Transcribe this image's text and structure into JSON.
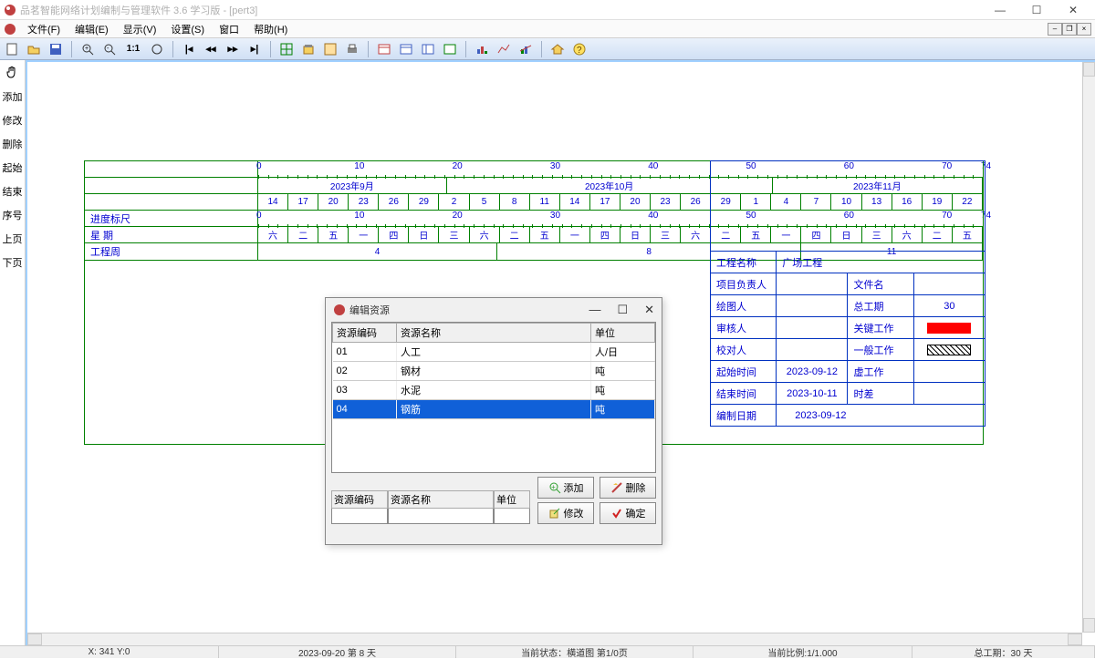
{
  "titlebar": {
    "text": "品茗智能网络计划编制与管理软件 3.6 学习版 - [pert3]"
  },
  "menu": {
    "file": "文件(F)",
    "edit": "编辑(E)",
    "view": "显示(V)",
    "settings": "设置(S)",
    "window": "窗口",
    "help": "帮助(H)"
  },
  "left_tools": [
    "添加",
    "修改",
    "删除",
    "起始",
    "结束",
    "序号",
    "上页",
    "下页"
  ],
  "gantt": {
    "scale_ticks": [
      "0",
      "10",
      "20",
      "30",
      "40",
      "50",
      "60",
      "70",
      "74"
    ],
    "months": [
      "2023年9月",
      "2023年10月",
      "2023年11月"
    ],
    "dates": [
      "14",
      "17",
      "20",
      "23",
      "26",
      "29",
      "2",
      "5",
      "8",
      "11",
      "14",
      "17",
      "20",
      "23",
      "26",
      "29",
      "1",
      "4",
      "7",
      "10",
      "13",
      "16",
      "19",
      "22"
    ],
    "row_scale_label": "进度标尺",
    "row_week_label": "星 期",
    "week_days": [
      "六",
      "二",
      "五",
      "一",
      "四",
      "日",
      "三",
      "六",
      "二",
      "五",
      "一",
      "四",
      "日",
      "三",
      "六",
      "二",
      "五",
      "一",
      "四",
      "日",
      "三",
      "六",
      "二",
      "五"
    ],
    "row_proj_label": "工程周",
    "proj_weeks": [
      "4",
      "8",
      "11"
    ],
    "scale2_ticks": [
      "0",
      "10",
      "20",
      "30",
      "40",
      "50",
      "60",
      "70",
      "74"
    ]
  },
  "info": {
    "proj_name_lbl": "工程名称",
    "proj_name_val": "广场工程",
    "leader_lbl": "项目负责人",
    "filename_lbl": "文件名",
    "drawer_lbl": "绘图人",
    "total_duration_lbl": "总工期",
    "total_duration_val": "30",
    "reviewer_lbl": "审核人",
    "critical_lbl": "关键工作",
    "verifier_lbl": "校对人",
    "normal_lbl": "一般工作",
    "start_lbl": "起始时间",
    "start_val": "2023-09-12",
    "dummy_lbl": "虚工作",
    "end_lbl": "结束时间",
    "end_val": "2023-10-11",
    "float_lbl": "时差",
    "prepare_lbl": "编制日期",
    "prepare_val": "2023-09-12"
  },
  "dialog": {
    "title": "编辑资源",
    "headers": {
      "code": "资源编码",
      "name": "资源名称",
      "unit": "单位"
    },
    "rows": [
      {
        "code": "01",
        "name": "人工",
        "unit": "人/日"
      },
      {
        "code": "02",
        "name": "钢材",
        "unit": "吨"
      },
      {
        "code": "03",
        "name": "水泥",
        "unit": "吨"
      },
      {
        "code": "04",
        "name": "钢筋",
        "unit": "吨"
      }
    ],
    "selected_index": 3,
    "input_labels": {
      "code": "资源编码",
      "name": "资源名称",
      "unit": "单位"
    },
    "buttons": {
      "add": "添加",
      "delete": "删除",
      "modify": "修改",
      "ok": "确定"
    }
  },
  "status": {
    "coord": "X: 341  Y:0",
    "date": "2023-09-20 第 8 天",
    "state": "当前状态：横道图 第1/0页",
    "ratio": "当前比例:1/1.000",
    "total": "总工期：30 天"
  }
}
